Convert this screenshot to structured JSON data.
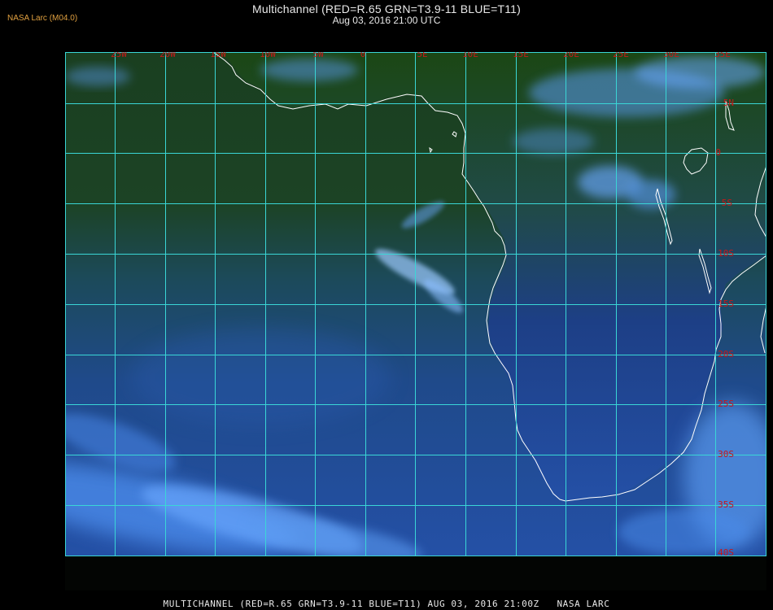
{
  "header": {
    "title": "Multichannel (RED=R.65 GRN=T3.9-11 BLUE=T11)",
    "date": "Aug 03, 2016 21:00 UTC",
    "source": "NASA Larc (M04.0)"
  },
  "map": {
    "lon_labels": [
      "25W",
      "20W",
      "15W",
      "10W",
      "5W",
      "0",
      "5E",
      "10E",
      "15E",
      "20E",
      "25E",
      "30E",
      "35E"
    ],
    "lat_labels": [
      "5N",
      "0",
      "5S",
      "10S",
      "15S",
      "20S",
      "25S",
      "30S",
      "35S",
      "40S"
    ],
    "colors": {
      "grid": "#3ad6d6",
      "labels": "#c81818",
      "coast": "#ffffff",
      "ocean": "#1f4a8a",
      "land": "#1d4a16",
      "cloud": "#5a9af0"
    }
  },
  "footer": {
    "caption": "MULTICHANNEL (RED=R.65 GRN=T3.9-11 BLUE=T11) AUG 03, 2016 21:00Z   NASA LARC"
  }
}
